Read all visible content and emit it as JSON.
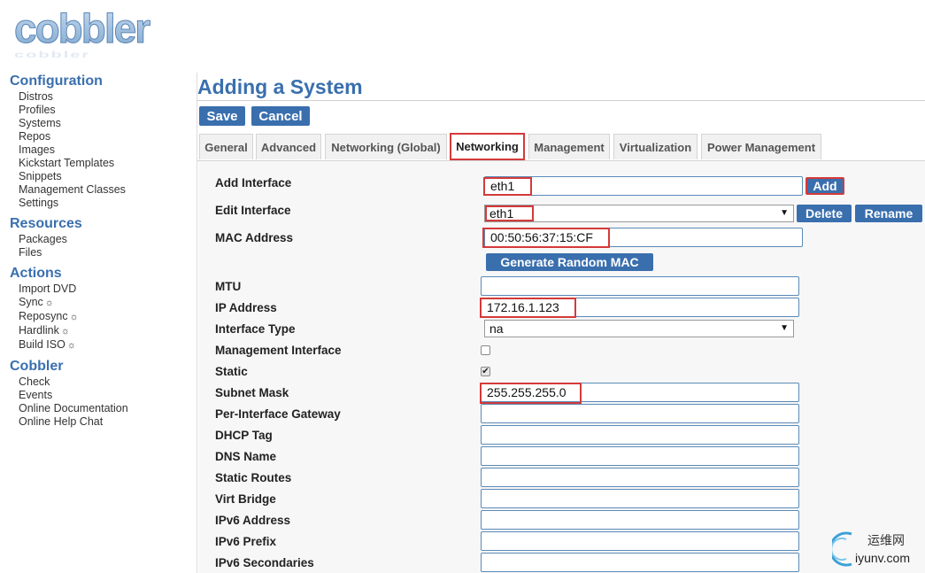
{
  "logo": {
    "text": "cobbler"
  },
  "sidebar": {
    "sections": [
      {
        "heading": "Configuration",
        "items": [
          "Distros",
          "Profiles",
          "Systems",
          "Repos",
          "Images",
          "Kickstart Templates",
          "Snippets",
          "Management Classes",
          "Settings"
        ]
      },
      {
        "heading": "Resources",
        "items": [
          "Packages",
          "Files"
        ]
      },
      {
        "heading": "Actions",
        "items": [
          "Import DVD",
          "Sync",
          "Reposync",
          "Hardlink",
          "Build ISO"
        ]
      },
      {
        "heading": "Cobbler",
        "items": [
          "Check",
          "Events",
          "Online Documentation",
          "Online Help Chat"
        ]
      }
    ],
    "action_icon": "☼"
  },
  "main": {
    "title": "Adding a System",
    "save_label": "Save",
    "cancel_label": "Cancel",
    "tabs": [
      "General",
      "Advanced",
      "Networking (Global)",
      "Networking",
      "Management",
      "Virtualization",
      "Power Management"
    ],
    "active_tab": "Networking"
  },
  "form": {
    "add_interface": {
      "label": "Add Interface",
      "value": "eth1",
      "button": "Add"
    },
    "edit_interface": {
      "label": "Edit Interface",
      "value": "eth1",
      "delete": "Delete",
      "rename": "Rename"
    },
    "mac_address": {
      "label": "MAC Address",
      "value": "00:50:56:37:15:CF",
      "generate": "Generate Random MAC"
    },
    "mtu": {
      "label": "MTU",
      "value": ""
    },
    "ip_address": {
      "label": "IP Address",
      "value": "172.16.1.123"
    },
    "interface_type": {
      "label": "Interface Type",
      "value": "na"
    },
    "management_interface": {
      "label": "Management Interface",
      "checked": false
    },
    "static": {
      "label": "Static",
      "checked": true
    },
    "subnet_mask": {
      "label": "Subnet Mask",
      "value": "255.255.255.0"
    },
    "per_interface_gateway": {
      "label": "Per-Interface Gateway",
      "value": ""
    },
    "dhcp_tag": {
      "label": "DHCP Tag",
      "value": ""
    },
    "dns_name": {
      "label": "DNS Name",
      "value": ""
    },
    "static_routes": {
      "label": "Static Routes",
      "value": ""
    },
    "virt_bridge": {
      "label": "Virt Bridge",
      "value": ""
    },
    "ipv6_address": {
      "label": "IPv6 Address",
      "value": ""
    },
    "ipv6_prefix": {
      "label": "IPv6 Prefix",
      "value": ""
    },
    "ipv6_secondaries": {
      "label": "IPv6 Secondaries",
      "value": ""
    }
  },
  "watermark": {
    "line1": "运维网",
    "line2": "iyunv.com"
  },
  "colors": {
    "accent": "#3a6fae",
    "highlight": "#d43a3a"
  }
}
